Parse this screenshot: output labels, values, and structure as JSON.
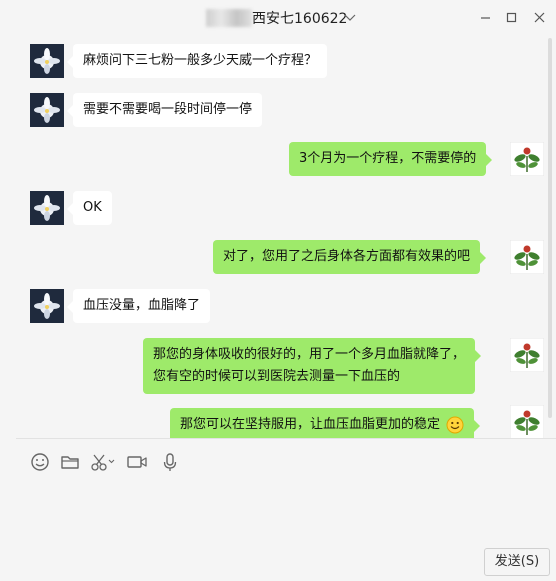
{
  "window": {
    "title": "西安七160622"
  },
  "messages": [
    {
      "side": "left",
      "text": "麻烦问下三七粉一般多少天威一个疗程？"
    },
    {
      "side": "left",
      "text": "需要不需要喝一段时间停一停"
    },
    {
      "side": "right",
      "text": "3个月为一个疗程，不需要停的"
    },
    {
      "side": "left",
      "text": "OK"
    },
    {
      "side": "right",
      "text": "对了，您用了之后身体各方面都有效果的吧"
    },
    {
      "side": "left",
      "text": "血压没量，血脂降了"
    },
    {
      "side": "right",
      "lines": [
        "那您的身体吸收的很好的，用了一个多月血脂就降了，",
        "您有空的时候可以到医院去测量一下血压的"
      ]
    },
    {
      "side": "right",
      "text": "那您可以在坚持服用，让血压血脂更加的稳定",
      "emoji": "smile-emoji"
    }
  ],
  "toolbar": {
    "icons": [
      "emoji-icon",
      "folder-icon",
      "scissors-icon",
      "video-call-icon",
      "microphone-icon"
    ]
  },
  "send": {
    "label": "发送(S)"
  },
  "colors": {
    "bubble_self": "#9eea6a",
    "bubble_other": "#ffffff",
    "background": "#f5f5f5"
  }
}
